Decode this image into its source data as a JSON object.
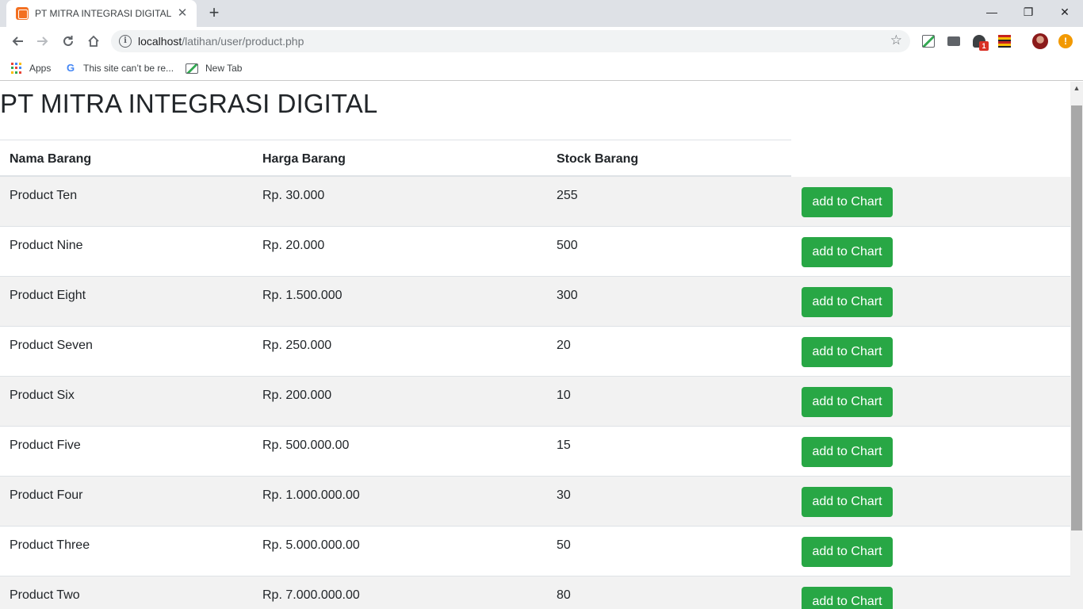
{
  "browser": {
    "tab_title": "PT MITRA INTEGRASI DIGITAL",
    "tab_close": "✕",
    "new_tab": "+",
    "window_minimize": "—",
    "window_restore": "❐",
    "window_close": "✕",
    "url_host": "localhost",
    "url_path": "/latihan/user/product.php",
    "bookmarks": {
      "apps": "Apps",
      "site": "This site can’t be re...",
      "new_tab": "New Tab"
    },
    "extension_badge": "1"
  },
  "page": {
    "title": "PT MITRA INTEGRASI DIGITAL",
    "headers": {
      "name": "Nama Barang",
      "price": "Harga Barang",
      "stock": "Stock Barang"
    },
    "button_label": "add to Chart",
    "products": [
      {
        "name": "Product Ten",
        "price": "Rp. 30.000",
        "stock": "255"
      },
      {
        "name": "Product Nine",
        "price": "Rp. 20.000",
        "stock": "500"
      },
      {
        "name": "Product Eight",
        "price": "Rp. 1.500.000",
        "stock": "300"
      },
      {
        "name": "Product Seven",
        "price": "Rp. 250.000",
        "stock": "20"
      },
      {
        "name": "Product Six",
        "price": "Rp. 200.000",
        "stock": "10"
      },
      {
        "name": "Product Five",
        "price": "Rp. 500.000.00",
        "stock": "15"
      },
      {
        "name": "Product Four",
        "price": "Rp. 1.000.000.00",
        "stock": "30"
      },
      {
        "name": "Product Three",
        "price": "Rp. 5.000.000.00",
        "stock": "50"
      },
      {
        "name": "Product Two",
        "price": "Rp. 7.000.000.00",
        "stock": "80"
      }
    ]
  },
  "colors": {
    "button_green": "#28a745",
    "striped_row": "#f2f2f2",
    "text": "#212529"
  }
}
